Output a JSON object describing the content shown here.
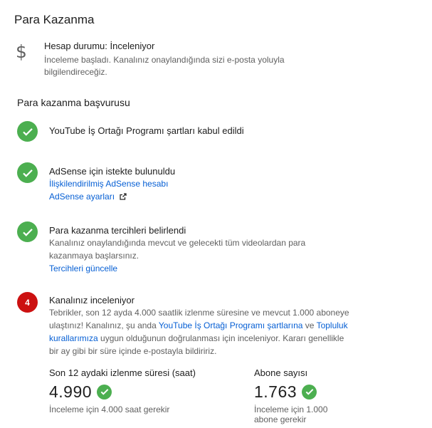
{
  "page": {
    "title": "Para Kazanma"
  },
  "status": {
    "icon": "dollar-icon",
    "title": "Hesap durumu: İnceleniyor",
    "description": "İnceleme başladı. Kanalınız onaylandığında sizi e-posta yoluyla bilgilendireceğiz."
  },
  "application": {
    "title": "Para kazanma başvurusu",
    "steps": [
      {
        "state": "done",
        "icon": "check-circle-icon",
        "title": "YouTube İş Ortağı Programı şartları kabul edildi"
      },
      {
        "state": "done",
        "icon": "check-circle-icon",
        "title": "AdSense için istekte bulunuldu",
        "link": "İlişkilendirilmiş AdSense hesabı",
        "link2": "AdSense ayarları",
        "link2_icon": "external-link-icon"
      },
      {
        "state": "done",
        "icon": "check-circle-icon",
        "title": "Para kazanma tercihleri belirlendi",
        "text": "Kanalınız onaylandığında mevcut ve gelecekti tüm videolardan para kazanmaya başlarsınız.",
        "link": "Tercihleri güncelle"
      },
      {
        "state": "current",
        "number": "4",
        "title": "Kanalınız inceleniyor",
        "text_part1": "Tebrikler, son 12 ayda 4.000 saatlik izlenme süresine ve mevcut 1.000 aboneye ulaştınız! Kanalınız, şu anda ",
        "link_a": "YouTube İş Ortağı Programı şartlarına",
        "text_part2": " ve ",
        "link_b": "Topluluk kurallarımıza",
        "text_part3": " uygun olduğunun doğrulanması için inceleniyor. Kararı genellikle bir ay gibi bir süre içinde e-postayla bildiririz."
      }
    ]
  },
  "metrics": [
    {
      "label": "Son 12 aydaki izlenme süresi (saat)",
      "value": "4.990",
      "note": "İnceleme için 4.000 saat gerekir"
    },
    {
      "label": "Abone sayısı",
      "value": "1.763",
      "note": "İnceleme için 1.000 abone gerekir"
    }
  ],
  "colors": {
    "accent_link": "#065fd4",
    "success": "#4caf50",
    "current_step": "#cc1111"
  }
}
